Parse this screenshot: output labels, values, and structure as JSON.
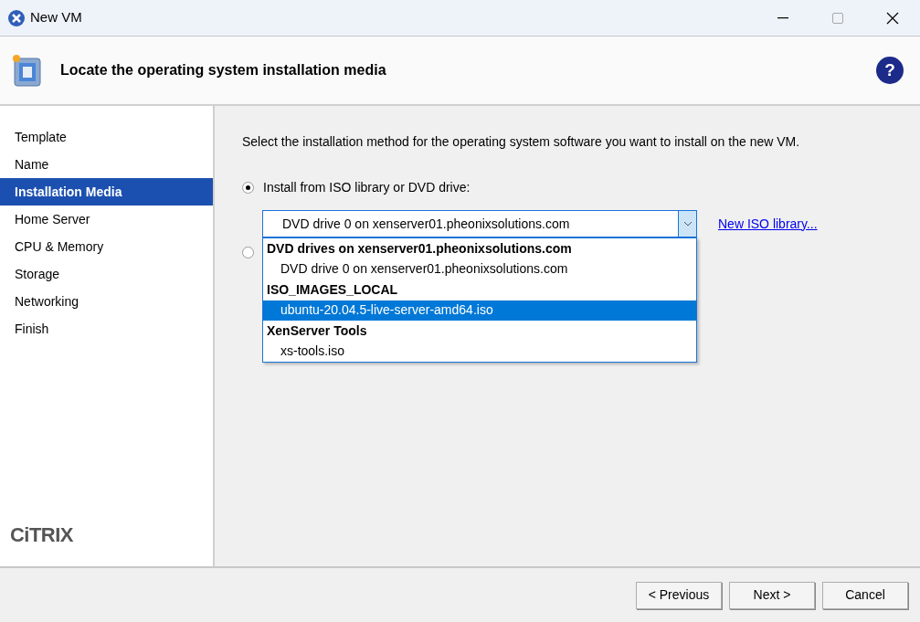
{
  "window": {
    "title": "New VM"
  },
  "header": {
    "title": "Locate the operating system installation media",
    "help": "?"
  },
  "sidebar": {
    "items": [
      {
        "label": "Template",
        "selected": false
      },
      {
        "label": "Name",
        "selected": false
      },
      {
        "label": "Installation Media",
        "selected": true
      },
      {
        "label": "Home Server",
        "selected": false
      },
      {
        "label": "CPU & Memory",
        "selected": false
      },
      {
        "label": "Storage",
        "selected": false
      },
      {
        "label": "Networking",
        "selected": false
      },
      {
        "label": "Finish",
        "selected": false
      }
    ],
    "logo": "CiTRIX"
  },
  "instruction": "Select the installation method for the operating system software you want to install on the new VM.",
  "options": [
    {
      "label": "Install from ISO library or DVD drive:",
      "selected": true
    },
    {
      "selected": false
    }
  ],
  "combobox": {
    "value": "DVD drive 0 on xenserver01.pheonixsolutions.com",
    "expanded": true
  },
  "link": "New ISO library...",
  "dropdown": [
    {
      "kind": "group",
      "label": "DVD drives on xenserver01.pheonixsolutions.com"
    },
    {
      "kind": "item",
      "label": "DVD drive 0 on xenserver01.pheonixsolutions.com",
      "selected": false
    },
    {
      "kind": "group",
      "label": "ISO_IMAGES_LOCAL"
    },
    {
      "kind": "item",
      "label": "ubuntu-20.04.5-live-server-amd64.iso",
      "selected": true
    },
    {
      "kind": "group",
      "label": "XenServer Tools"
    },
    {
      "kind": "item",
      "label": "xs-tools.iso",
      "selected": false
    }
  ],
  "buttons": [
    "< Previous",
    "Next >",
    "Cancel"
  ]
}
